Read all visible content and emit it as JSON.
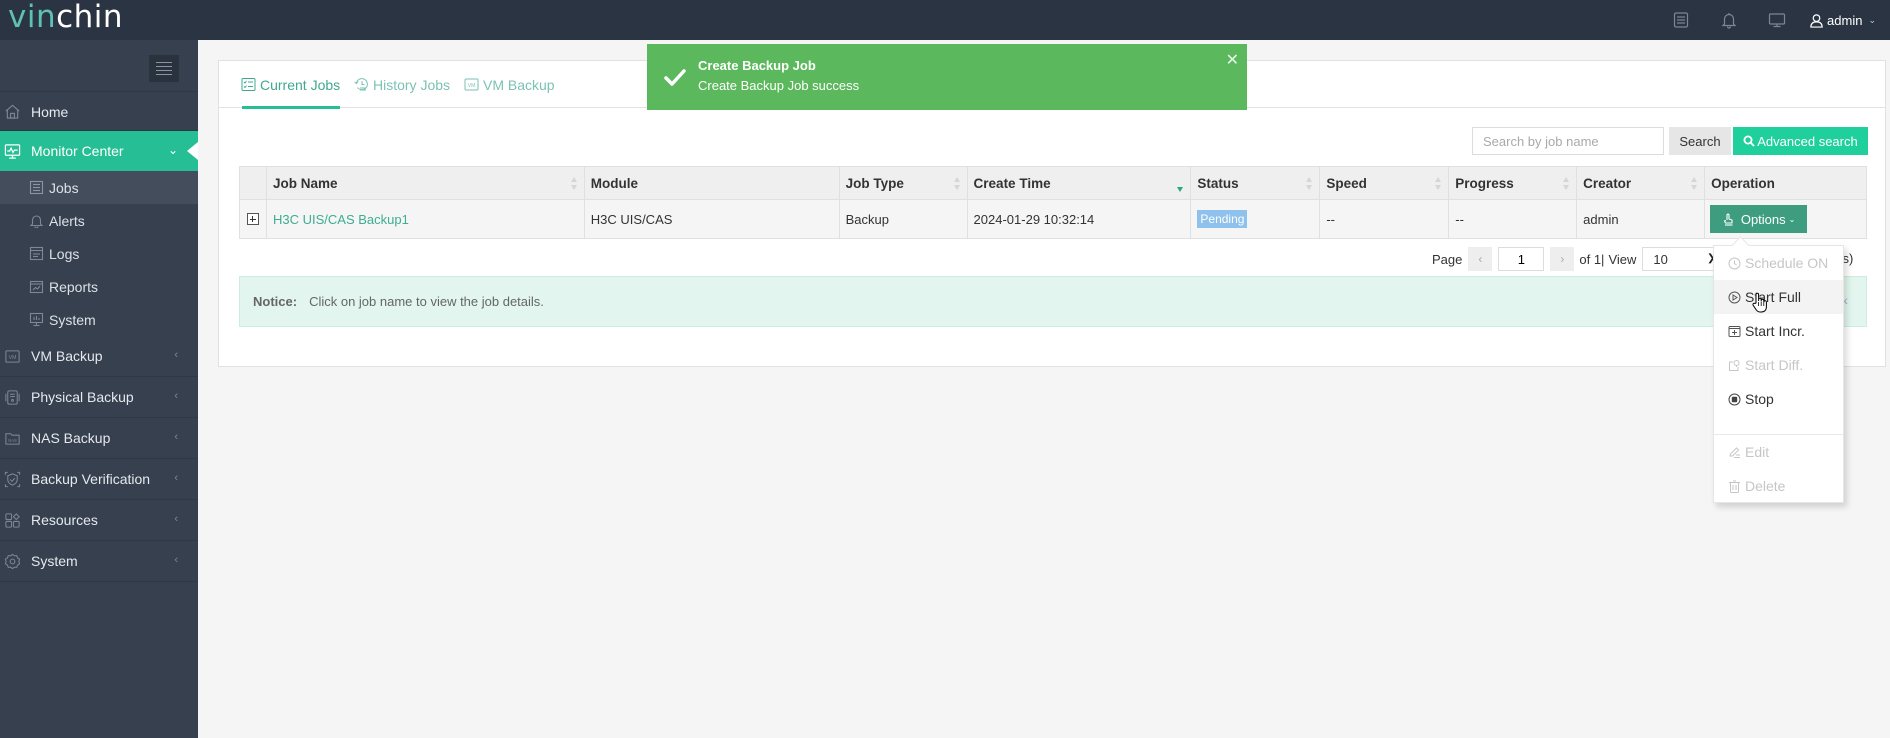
{
  "brand": {
    "logo_part1": "vin",
    "logo_part2": "chin",
    "accent": "#26bf95"
  },
  "topbar": {
    "icons": [
      "task-list-icon",
      "bell-icon",
      "monitor-icon"
    ],
    "user": "admin"
  },
  "sidebar": {
    "items": [
      {
        "label": "Home",
        "icon": "home-icon"
      },
      {
        "label": "Monitor Center",
        "icon": "monitor-center-icon",
        "active": true,
        "children": [
          {
            "label": "Jobs",
            "icon": "list-icon",
            "active": true
          },
          {
            "label": "Alerts",
            "icon": "bell-icon"
          },
          {
            "label": "Logs",
            "icon": "log-icon"
          },
          {
            "label": "Reports",
            "icon": "report-icon"
          },
          {
            "label": "System",
            "icon": "system-chart-icon"
          }
        ]
      },
      {
        "label": "VM Backup",
        "icon": "vm-icon"
      },
      {
        "label": "Physical Backup",
        "icon": "physical-icon"
      },
      {
        "label": "NAS Backup",
        "icon": "nas-icon"
      },
      {
        "label": "Backup Verification",
        "icon": "shield-check-icon"
      },
      {
        "label": "Resources",
        "icon": "resources-icon"
      },
      {
        "label": "System",
        "icon": "gear-icon"
      }
    ]
  },
  "tabs": [
    {
      "label": "Current Jobs",
      "active": true
    },
    {
      "label": "History Jobs"
    },
    {
      "label": "VM Backup"
    }
  ],
  "search": {
    "placeholder": "Search by job name",
    "value": "",
    "search_label": "Search",
    "advanced_label": "Advanced search"
  },
  "table": {
    "columns": [
      "",
      "Job Name",
      "Module",
      "Job Type",
      "Create Time",
      "Status",
      "Speed",
      "Progress",
      "Creator",
      "Operation"
    ],
    "rows": [
      {
        "job_name": "H3C UIS/CAS Backup1",
        "module": "H3C UIS/CAS",
        "job_type": "Backup",
        "create_time": "2024-01-29 10:32:14",
        "status": "Pending",
        "speed": "--",
        "progress": "--",
        "creator": "admin",
        "operation": "Options"
      }
    ]
  },
  "pagination": {
    "page_label": "Page",
    "page_value": "1",
    "of_label": "of 1|",
    "view_label": "View",
    "view_value": "10",
    "total_visible": "d(s)"
  },
  "notice": {
    "label": "Notice:",
    "text": "Click on job name to view the job details."
  },
  "toast": {
    "title": "Create Backup Job",
    "message": "Create Backup Job success",
    "color": "#5cb85c"
  },
  "options_menu": {
    "items": [
      {
        "label": "Schedule ON",
        "icon": "clock-icon",
        "disabled": true
      },
      {
        "label": "Start Full",
        "icon": "play-circle-icon",
        "hover": true
      },
      {
        "label": "Start Incr.",
        "icon": "incremental-icon"
      },
      {
        "label": "Start Diff.",
        "icon": "differential-icon",
        "disabled": true
      },
      {
        "label": "Stop",
        "icon": "stop-circle-icon"
      },
      {
        "label": "Edit",
        "icon": "edit-icon",
        "disabled": true
      },
      {
        "label": "Delete",
        "icon": "trash-icon",
        "disabled": true
      }
    ]
  }
}
